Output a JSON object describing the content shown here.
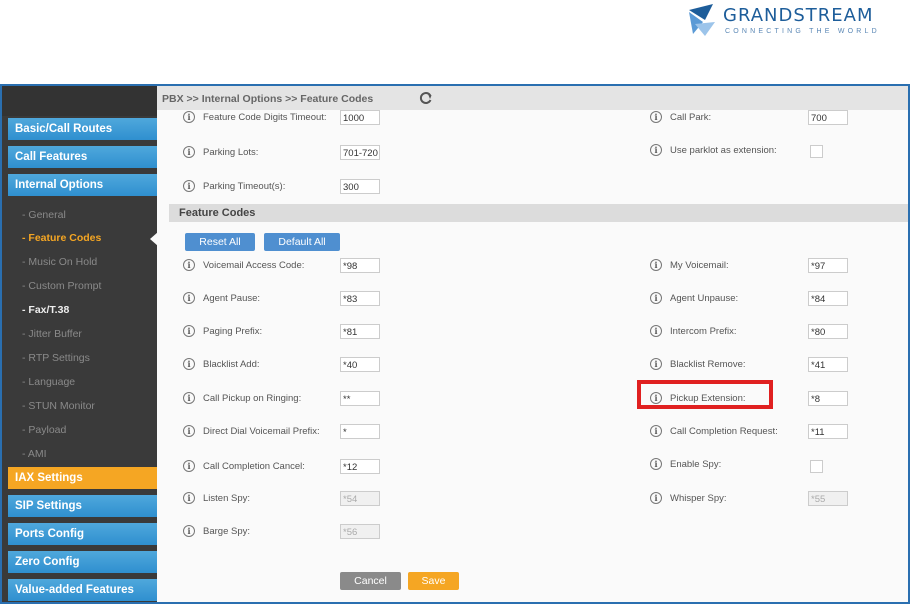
{
  "logo": {
    "name": "GRANDSTREAM",
    "tagline": "CONNECTING THE WORLD"
  },
  "breadcrumb": "PBX >> Internal Options >> Feature Codes",
  "sidebar": {
    "main_items": [
      "Basic/Call Routes",
      "Call Features",
      "Internal Options",
      "IAX Settings",
      "SIP Settings",
      "Ports Config",
      "Zero Config",
      "Value-added Features"
    ],
    "sub_items": [
      "General",
      "Feature Codes",
      "Music On Hold",
      "Custom Prompt",
      "Fax/T.38",
      "Jitter Buffer",
      "RTP Settings",
      "Language",
      "STUN Monitor",
      "Payload",
      "AMI"
    ]
  },
  "top_fields": {
    "digits_timeout_label": "Feature Code Digits Timeout:",
    "digits_timeout_value": "1000",
    "call_park_label": "Call Park:",
    "call_park_value": "700",
    "parking_lots_label": "Parking Lots:",
    "parking_lots_value": "701-720",
    "use_parklot_label": "Use parklot as extension:",
    "parking_timeout_label": "Parking Timeout(s):",
    "parking_timeout_value": "300"
  },
  "section_title": "Feature Codes",
  "buttons": {
    "reset_all": "Reset All",
    "default_all": "Default All",
    "cancel": "Cancel",
    "save": "Save"
  },
  "codes": {
    "voicemail_access_label": "Voicemail Access Code:",
    "voicemail_access_value": "*98",
    "my_voicemail_label": "My Voicemail:",
    "my_voicemail_value": "*97",
    "agent_pause_label": "Agent Pause:",
    "agent_pause_value": "*83",
    "agent_unpause_label": "Agent Unpause:",
    "agent_unpause_value": "*84",
    "paging_prefix_label": "Paging Prefix:",
    "paging_prefix_value": "*81",
    "intercom_prefix_label": "Intercom Prefix:",
    "intercom_prefix_value": "*80",
    "blacklist_add_label": "Blacklist Add:",
    "blacklist_add_value": "*40",
    "blacklist_remove_label": "Blacklist Remove:",
    "blacklist_remove_value": "*41",
    "pickup_ringing_label": "Call Pickup on Ringing:",
    "pickup_ringing_value": "**",
    "pickup_extension_label": "Pickup Extension:",
    "pickup_extension_value": "*8",
    "direct_dial_label": "Direct Dial Voicemail Prefix:",
    "direct_dial_value": "*",
    "completion_request_label": "Call Completion Request:",
    "completion_request_value": "*11",
    "completion_cancel_label": "Call Completion Cancel:",
    "completion_cancel_value": "*12",
    "enable_spy_label": "Enable Spy:",
    "listen_spy_label": "Listen Spy:",
    "listen_spy_value": "*54",
    "whisper_spy_label": "Whisper Spy:",
    "whisper_spy_value": "*55",
    "barge_spy_label": "Barge Spy:",
    "barge_spy_value": "*56"
  },
  "colors": {
    "accent_orange": "#f5a623",
    "menu_blue": "#2f8fcf",
    "highlight_red": "#e02020"
  }
}
